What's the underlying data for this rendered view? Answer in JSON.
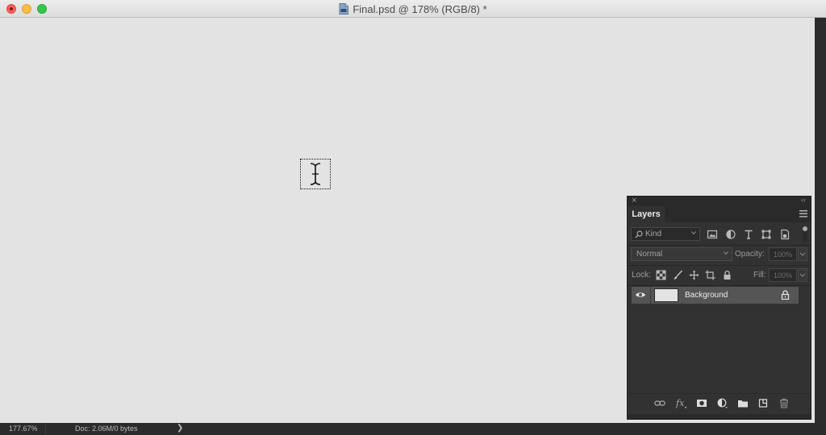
{
  "window": {
    "title": "Final.psd @ 178% (RGB/8) *"
  },
  "canvas": {
    "color": "#e3e3e3",
    "cursor": "text-cursor-icon"
  },
  "status_bar": {
    "zoom": "177.67%",
    "doc_info": "Doc: 2.06M/0 bytes",
    "arrow": "❯"
  },
  "layers_panel": {
    "tab_label": "Layers",
    "filter": {
      "kind_label": "Kind",
      "icons": [
        "image-filter-icon",
        "adjustment-filter-icon",
        "type-filter-icon",
        "shape-filter-icon",
        "smart-object-filter-icon"
      ]
    },
    "blend_mode": "Normal",
    "opacity_label": "Opacity:",
    "opacity_value": "100%",
    "lock_label": "Lock:",
    "lock_icons": [
      "lock-transparent-pixels-icon",
      "lock-image-pixels-icon",
      "lock-position-icon",
      "lock-artboard-icon",
      "lock-all-icon"
    ],
    "fill_label": "Fill:",
    "fill_value": "100%",
    "layers": [
      {
        "name": "Background",
        "visible": true,
        "locked": true,
        "thumbnail_color": "#e3e3e3"
      }
    ],
    "bottom_icons": [
      "link-layers-icon",
      "layer-style-icon",
      "layer-mask-icon",
      "adjustment-layer-icon",
      "group-folder-icon",
      "new-layer-icon",
      "delete-layer-icon"
    ]
  }
}
